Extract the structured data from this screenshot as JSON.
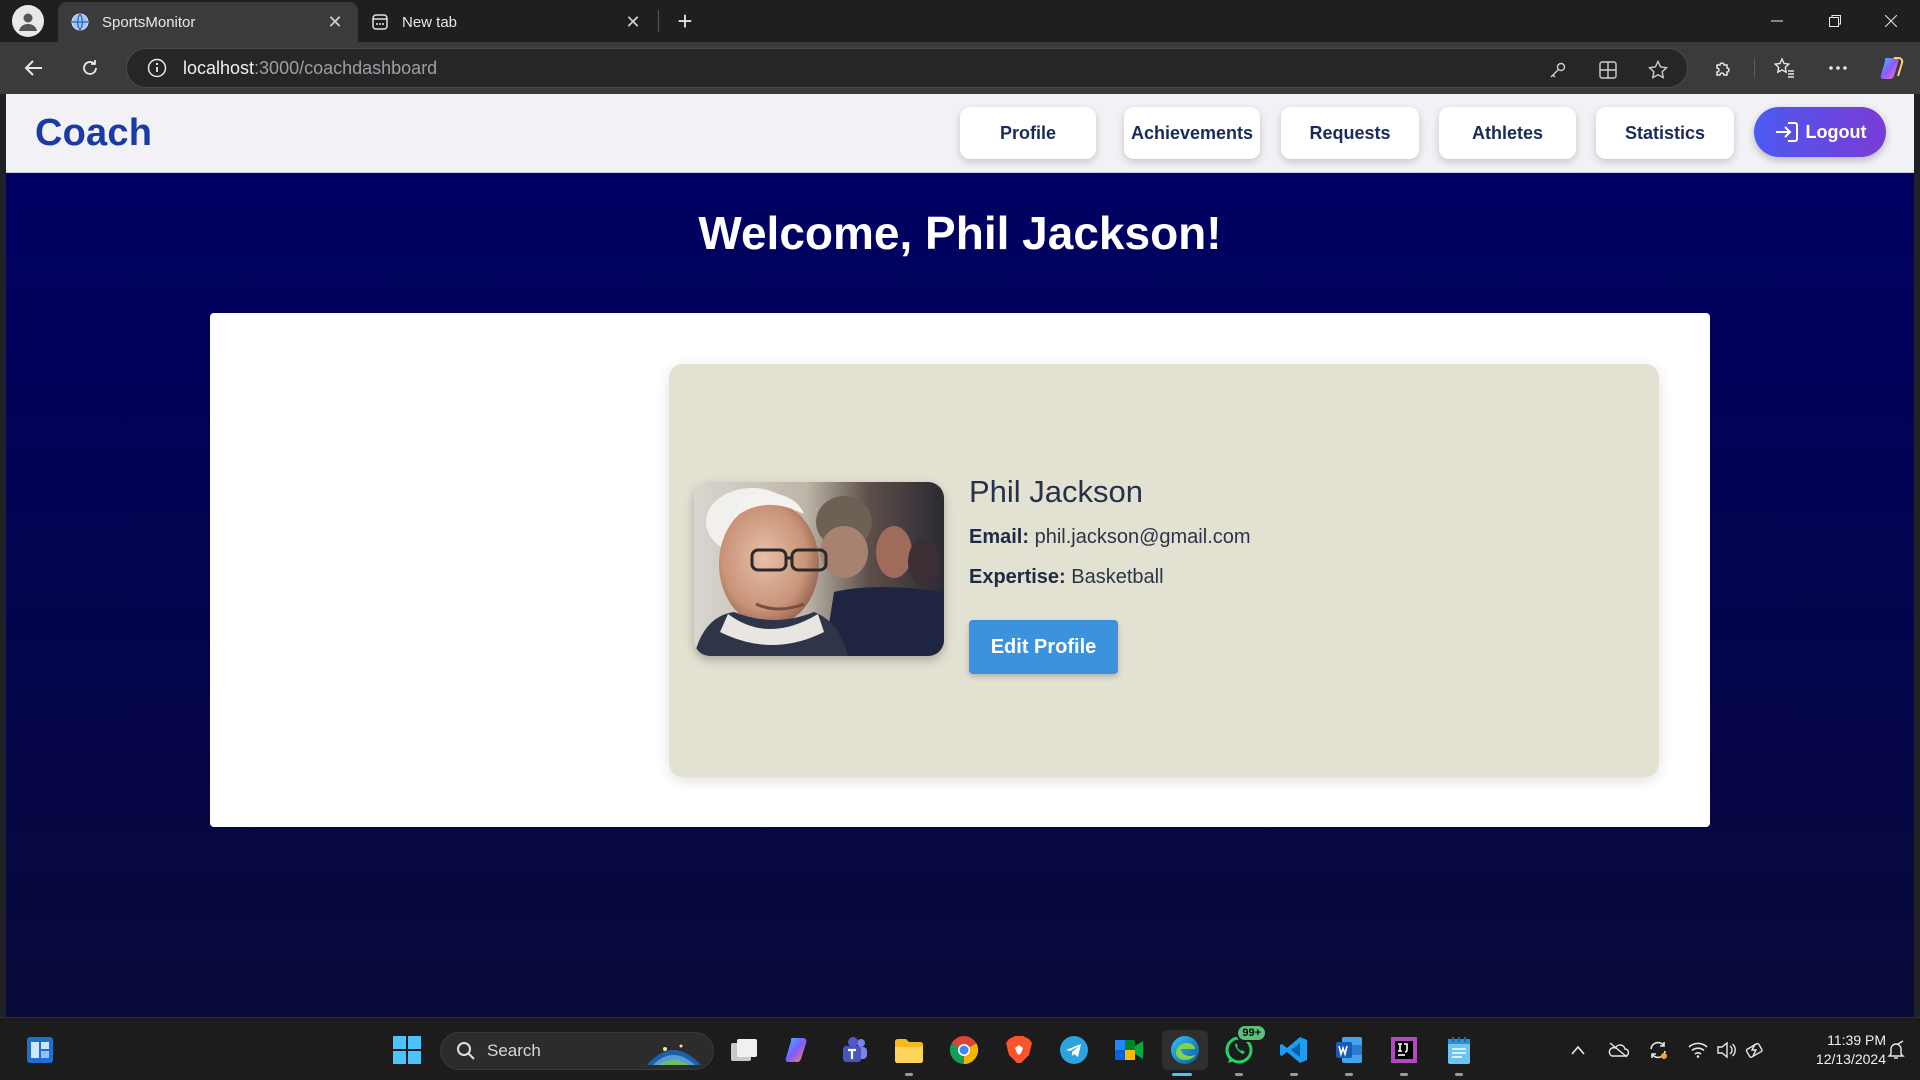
{
  "browser": {
    "tabs": [
      {
        "title": "SportsMonitor",
        "active": true
      },
      {
        "title": "New tab",
        "active": false
      }
    ],
    "url_host": "localhost",
    "url_path": ":3000/coachdashboard"
  },
  "app": {
    "brand": "Coach",
    "nav": [
      {
        "label": "Profile"
      },
      {
        "label": "Achievements"
      },
      {
        "label": "Requests"
      },
      {
        "label": "Athletes"
      },
      {
        "label": "Statistics"
      }
    ],
    "logout_label": "Logout"
  },
  "main": {
    "welcome": "Welcome, Phil Jackson!",
    "profile": {
      "name": "Phil Jackson",
      "email_label": "Email:",
      "email": "phil.jackson@gmail.com",
      "expertise_label": "Expertise:",
      "expertise": "Basketball",
      "edit_label": "Edit Profile"
    }
  },
  "taskbar": {
    "search_placeholder": "Search",
    "whatsapp_badge": "99+",
    "time": "11:39 PM",
    "date": "12/13/2024"
  },
  "colors": {
    "brand": "#1a3aa6",
    "page_bg": "#000068",
    "card_bg": "#e3e1d2",
    "edit_button": "#3b93de",
    "logout_gradient_start": "#4b5af0",
    "logout_gradient_end": "#7b3bd6"
  }
}
